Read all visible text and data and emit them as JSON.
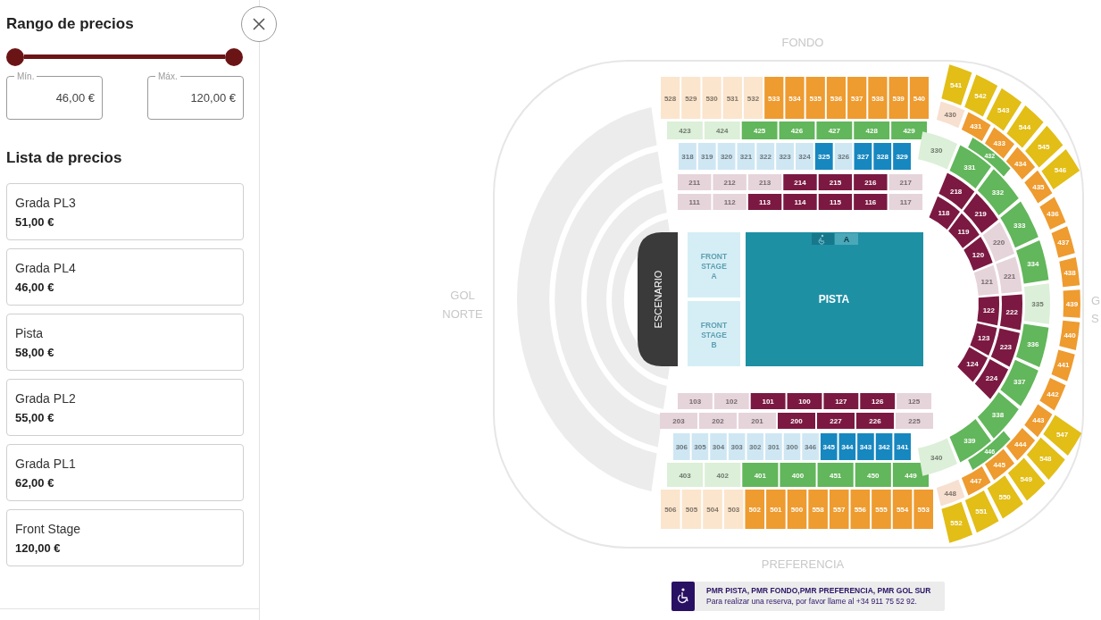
{
  "filter": {
    "title": "Rango de precios",
    "thumbs": [
      {
        "level": 0
      },
      {
        "level": 1
      }
    ],
    "fields": [
      {
        "label": "Mín.",
        "value": "46,00 €"
      },
      {
        "label": "Máx.",
        "value": "120,00 €"
      }
    ]
  },
  "price_list": {
    "title": "Lista de precios",
    "items": [
      {
        "name": "Grada PL3",
        "price": "51,00 €"
      },
      {
        "name": "Grada PL4",
        "price": "46,00 €"
      },
      {
        "name": "Pista",
        "price": "58,00 €"
      },
      {
        "name": "Grada PL2",
        "price": "55,00 €"
      },
      {
        "name": "Grada PL1",
        "price": "62,00 €"
      },
      {
        "name": "Front Stage",
        "price": "120,00 €"
      }
    ]
  },
  "map": {
    "top_label": "FONDO",
    "bottom_label": "PREFERENCIA",
    "left_label": [
      "GOL",
      "NORTE"
    ],
    "right_label": [
      "G",
      "S"
    ],
    "stage": "ESCENARIO",
    "front_stages": [
      [
        "FRONT",
        "STAGE",
        "A"
      ],
      [
        "FRONT",
        "STAGE",
        "B"
      ]
    ],
    "pista": {
      "label": "PISTA",
      "tabs": [
        {
          "label": "A"
        }
      ]
    },
    "rows": [
      {
        "sections": [
          {
            "label": "528",
            "color": "#fbe5cd"
          },
          {
            "label": "529",
            "color": "#fbe5cd"
          },
          {
            "label": "530",
            "color": "#fbe5cd"
          },
          {
            "label": "531",
            "color": "#fbe5cd"
          },
          {
            "label": "532",
            "color": "#fbe5cd"
          },
          {
            "label": "533",
            "color": "#ee9b2f"
          },
          {
            "label": "534",
            "color": "#ee9b2f"
          },
          {
            "label": "535",
            "color": "#ee9b2f"
          },
          {
            "label": "536",
            "color": "#ee9b2f"
          },
          {
            "label": "537",
            "color": "#ee9b2f"
          },
          {
            "label": "538",
            "color": "#ee9b2f"
          },
          {
            "label": "539",
            "color": "#ee9b2f"
          },
          {
            "label": "540",
            "color": "#ee9b2f"
          }
        ]
      },
      {
        "sections": [
          {
            "label": "423",
            "color": "#dcefd8"
          },
          {
            "label": "424",
            "color": "#dcefd8"
          },
          {
            "label": "425",
            "color": "#62b65b"
          },
          {
            "label": "426",
            "color": "#62b65b"
          },
          {
            "label": "427",
            "color": "#62b65b"
          },
          {
            "label": "428",
            "color": "#62b65b"
          },
          {
            "label": "429",
            "color": "#62b65b"
          }
        ]
      },
      {
        "sections": [
          {
            "label": "318",
            "color": "#cfe7f3"
          },
          {
            "label": "319",
            "color": "#cfe7f3"
          },
          {
            "label": "320",
            "color": "#cfe7f3"
          },
          {
            "label": "321",
            "color": "#cfe7f3"
          },
          {
            "label": "322",
            "color": "#cfe7f3"
          },
          {
            "label": "323",
            "color": "#cfe7f3"
          },
          {
            "label": "324",
            "color": "#cfe7f3"
          },
          {
            "label": "325",
            "color": "#1787c0"
          },
          {
            "label": "326",
            "color": "#cfe7f3"
          },
          {
            "label": "327",
            "color": "#1787c0"
          },
          {
            "label": "328",
            "color": "#1787c0"
          },
          {
            "label": "329",
            "color": "#1787c0"
          }
        ]
      },
      {
        "sections": [
          {
            "label": "211",
            "color": "#e6d4db"
          },
          {
            "label": "212",
            "color": "#e6d4db"
          },
          {
            "label": "213",
            "color": "#e6d4db"
          },
          {
            "label": "214",
            "color": "#7b1942"
          },
          {
            "label": "215",
            "color": "#7b1942"
          },
          {
            "label": "216",
            "color": "#7b1942"
          },
          {
            "label": "217",
            "color": "#e6d4db"
          }
        ]
      },
      {
        "sections": [
          {
            "label": "111",
            "color": "#e6d4db"
          },
          {
            "label": "112",
            "color": "#e6d4db"
          },
          {
            "label": "113",
            "color": "#7b1942"
          },
          {
            "label": "114",
            "color": "#7b1942"
          },
          {
            "label": "115",
            "color": "#7b1942"
          },
          {
            "label": "116",
            "color": "#7b1942"
          },
          {
            "label": "117",
            "color": "#e6d4db"
          }
        ]
      },
      {
        "sections": [
          {
            "label": "103",
            "color": "#e6d4db"
          },
          {
            "label": "102",
            "color": "#e6d4db"
          },
          {
            "label": "101",
            "color": "#7b1942"
          },
          {
            "label": "100",
            "color": "#7b1942"
          },
          {
            "label": "127",
            "color": "#7b1942"
          },
          {
            "label": "126",
            "color": "#7b1942"
          },
          {
            "label": "125",
            "color": "#e6d4db"
          }
        ]
      },
      {
        "sections": [
          {
            "label": "203",
            "color": "#e6d4db"
          },
          {
            "label": "202",
            "color": "#e6d4db"
          },
          {
            "label": "201",
            "color": "#e6d4db"
          },
          {
            "label": "200",
            "color": "#7b1942"
          },
          {
            "label": "227",
            "color": "#7b1942"
          },
          {
            "label": "226",
            "color": "#7b1942"
          },
          {
            "label": "225",
            "color": "#e6d4db"
          }
        ]
      },
      {
        "sections": [
          {
            "label": "306",
            "color": "#cfe7f3"
          },
          {
            "label": "305",
            "color": "#cfe7f3"
          },
          {
            "label": "304",
            "color": "#cfe7f3"
          },
          {
            "label": "303",
            "color": "#cfe7f3"
          },
          {
            "label": "302",
            "color": "#cfe7f3"
          },
          {
            "label": "301",
            "color": "#cfe7f3"
          },
          {
            "label": "300",
            "color": "#cfe7f3"
          },
          {
            "label": "346",
            "color": "#cfe7f3"
          },
          {
            "label": "345",
            "color": "#1787c0"
          },
          {
            "label": "344",
            "color": "#1787c0"
          },
          {
            "label": "343",
            "color": "#1787c0"
          },
          {
            "label": "342",
            "color": "#1787c0"
          },
          {
            "label": "341",
            "color": "#1787c0"
          }
        ]
      },
      {
        "sections": [
          {
            "label": "403",
            "color": "#dcefd8"
          },
          {
            "label": "402",
            "color": "#dcefd8"
          },
          {
            "label": "401",
            "color": "#62b65b"
          },
          {
            "label": "400",
            "color": "#62b65b"
          },
          {
            "label": "451",
            "color": "#62b65b"
          },
          {
            "label": "450",
            "color": "#62b65b"
          },
          {
            "label": "449",
            "color": "#62b65b"
          }
        ]
      },
      {
        "sections": [
          {
            "label": "506",
            "color": "#fbe5cd"
          },
          {
            "label": "505",
            "color": "#fbe5cd"
          },
          {
            "label": "504",
            "color": "#fbe5cd"
          },
          {
            "label": "503",
            "color": "#fbe5cd"
          },
          {
            "label": "502",
            "color": "#ee9b2f"
          },
          {
            "label": "501",
            "color": "#ee9b2f"
          },
          {
            "label": "500",
            "color": "#ee9b2f"
          },
          {
            "label": "558",
            "color": "#ee9b2f"
          },
          {
            "label": "557",
            "color": "#ee9b2f"
          },
          {
            "label": "556",
            "color": "#ee9b2f"
          },
          {
            "label": "555",
            "color": "#ee9b2f"
          },
          {
            "label": "554",
            "color": "#ee9b2f"
          },
          {
            "label": "553",
            "color": "#ee9b2f"
          }
        ]
      }
    ],
    "rings": [
      {
        "sections": [
          {
            "label": "118",
            "color": "#7b1942"
          },
          {
            "label": "119",
            "color": "#7b1942"
          },
          {
            "label": "120",
            "color": "#7b1942"
          },
          {
            "label": "121",
            "color": "#e6d4db"
          },
          {
            "label": "122",
            "color": "#7b1942"
          },
          {
            "label": "123",
            "color": "#7b1942"
          },
          {
            "label": "124",
            "color": "#7b1942"
          }
        ]
      },
      {
        "sections": [
          {
            "label": "218",
            "color": "#7b1942"
          },
          {
            "label": "219",
            "color": "#7b1942"
          },
          {
            "label": "220",
            "color": "#e6d4db"
          },
          {
            "label": "221",
            "color": "#e6d4db"
          },
          {
            "label": "222",
            "color": "#7b1942"
          },
          {
            "label": "223",
            "color": "#7b1942"
          },
          {
            "label": "224",
            "color": "#7b1942"
          }
        ]
      },
      {
        "sections": [
          {
            "label": "330",
            "color": "#dcefd8"
          },
          {
            "label": "331",
            "color": "#62b65b"
          },
          {
            "label": "332",
            "color": "#62b65b"
          },
          {
            "label": "333",
            "color": "#62b65b"
          },
          {
            "label": "334",
            "color": "#62b65b"
          },
          {
            "label": "335",
            "color": "#dcefd8"
          },
          {
            "label": "336",
            "color": "#62b65b"
          },
          {
            "label": "337",
            "color": "#62b65b"
          },
          {
            "label": "338",
            "color": "#62b65b"
          },
          {
            "label": "339",
            "color": "#62b65b"
          },
          {
            "label": "340",
            "color": "#dcefd8"
          }
        ]
      },
      {
        "sections": [
          {
            "label": "432",
            "color": "#62b65b"
          },
          {
            "label": "446",
            "color": "#62b65b"
          }
        ]
      },
      {
        "sections": [
          {
            "label": "430",
            "color": "#f7e0d0"
          },
          {
            "label": "431",
            "color": "#ee9b2f"
          },
          {
            "label": "433",
            "color": "#ee9b2f"
          },
          {
            "label": "434",
            "color": "#ee9b2f"
          },
          {
            "label": "435",
            "color": "#ee9b2f"
          },
          {
            "label": "436",
            "color": "#ee9b2f"
          },
          {
            "label": "437",
            "color": "#ee9b2f"
          },
          {
            "label": "438",
            "color": "#ee9b2f"
          },
          {
            "label": "439",
            "color": "#ee9b2f"
          },
          {
            "label": "440",
            "color": "#ee9b2f"
          },
          {
            "label": "441",
            "color": "#ee9b2f"
          },
          {
            "label": "442",
            "color": "#ee9b2f"
          },
          {
            "label": "443",
            "color": "#ee9b2f"
          },
          {
            "label": "444",
            "color": "#ee9b2f"
          },
          {
            "label": "445",
            "color": "#ee9b2f"
          },
          {
            "label": "447",
            "color": "#ee9b2f"
          },
          {
            "label": "448",
            "color": "#f7e0d0"
          }
        ]
      },
      {
        "sections": [
          {
            "label": "541",
            "color": "#e2be16"
          },
          {
            "label": "542",
            "color": "#e2be16"
          },
          {
            "label": "543",
            "color": "#e2be16"
          },
          {
            "label": "544",
            "color": "#e2be16"
          },
          {
            "label": "545",
            "color": "#e2be16"
          },
          {
            "label": "546",
            "color": "#e2be16"
          }
        ]
      },
      {
        "sections": [
          {
            "label": "547",
            "color": "#e2be16"
          },
          {
            "label": "548",
            "color": "#e2be16"
          },
          {
            "label": "549",
            "color": "#e2be16"
          },
          {
            "label": "550",
            "color": "#e2be16"
          },
          {
            "label": "551",
            "color": "#e2be16"
          },
          {
            "label": "552",
            "color": "#e2be16"
          }
        ]
      }
    ],
    "legend": {
      "title": "PMR PISTA, PMR FONDO,PMR PREFERENCIA, PMR GOL SUR",
      "text": "Para realizar una reserva, por favor llame al +34 911 75 52 92."
    }
  }
}
